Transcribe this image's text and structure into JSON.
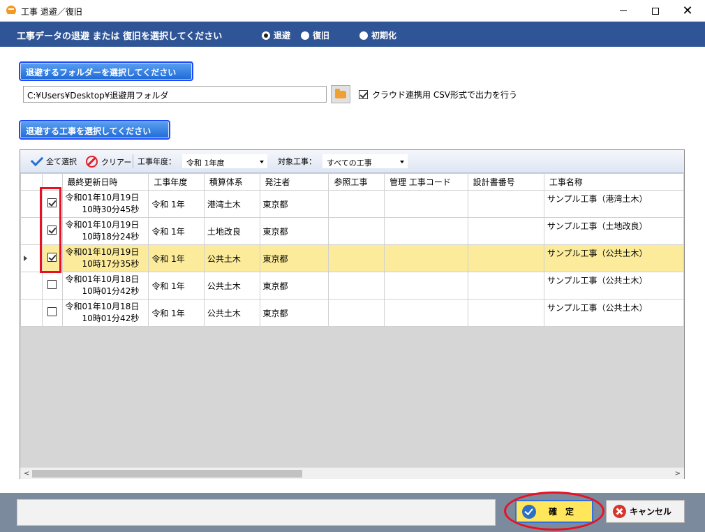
{
  "window": {
    "title": "工事 退避／復旧",
    "minimize": "",
    "maximize": "",
    "close": "✕"
  },
  "header": {
    "text": "工事データの退避 または 復旧を選択してください",
    "radios": [
      {
        "label": "退避",
        "checked": true
      },
      {
        "label": "復旧",
        "checked": false
      },
      {
        "label": "初期化",
        "checked": false
      }
    ]
  },
  "folder": {
    "select_button": "退避するフォルダーを選択してください",
    "path_value": "C:¥Users¥Desktop¥退避用フォルダ",
    "csv_label": "クラウド連携用 CSV形式で出力を行う",
    "csv_checked": true
  },
  "project_select_button": "退避する工事を選択してください",
  "toolbar": {
    "select_all": "全て選択",
    "clear": "クリアー",
    "year_label": "工事年度：",
    "year_value": "令和 1年度",
    "target_label": "対象工事：",
    "target_value": "すべての工事"
  },
  "grid": {
    "columns": [
      "最終更新日時",
      "工事年度",
      "積算体系",
      "発注者",
      "参照工事",
      "管理 工事コード",
      "設計書番号",
      "工事名称"
    ],
    "rows": [
      {
        "checked": true,
        "date": "令和01年10月19日",
        "time": "10時30分45秒",
        "year": "令和 1年",
        "system": "港湾土木",
        "client": "東京都",
        "ref": "",
        "code": "",
        "design_no": "",
        "name": "サンプル工事（港湾土木）"
      },
      {
        "checked": true,
        "date": "令和01年10月19日",
        "time": "10時18分24秒",
        "year": "令和 1年",
        "system": "土地改良",
        "client": "東京都",
        "ref": "",
        "code": "",
        "design_no": "",
        "name": "サンプル工事（土地改良）"
      },
      {
        "checked": true,
        "date": "令和01年10月19日",
        "time": "10時17分35秒",
        "year": "令和 1年",
        "system": "公共土木",
        "client": "東京都",
        "ref": "",
        "code": "",
        "design_no": "",
        "name": "サンプル工事（公共土木）"
      },
      {
        "checked": false,
        "date": "令和01年10月18日",
        "time": "10時01分42秒",
        "year": "令和 1年",
        "system": "公共土木",
        "client": "東京都",
        "ref": "",
        "code": "",
        "design_no": "",
        "name": "サンプル工事（公共土木）"
      },
      {
        "checked": false,
        "date": "令和01年10月18日",
        "time": "10時01分42秒",
        "year": "令和 1年",
        "system": "公共土木",
        "client": "東京都",
        "ref": "",
        "code": "",
        "design_no": "",
        "name": "サンプル工事（公共土木）"
      }
    ],
    "selected_row": 2
  },
  "footer": {
    "status_text": "",
    "ok_label": "確　定",
    "cancel_label": "キャンセル"
  },
  "colors": {
    "header_band": "#2f5597",
    "selected_row": "#fbeb9a",
    "ok_button": "#ffe65a",
    "highlight": "#e81123"
  }
}
